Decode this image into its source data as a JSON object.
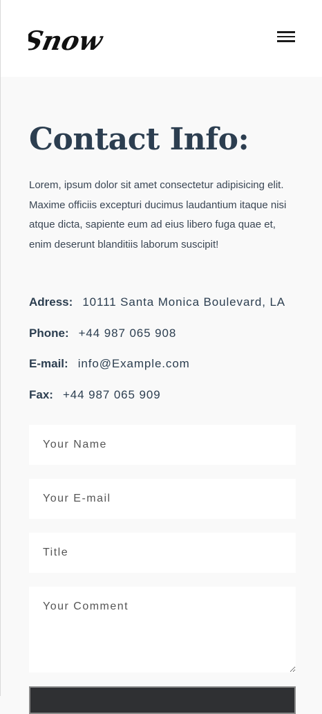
{
  "header": {
    "logo_text": "Snow",
    "menu_icon": "hamburger-menu-icon"
  },
  "contact": {
    "title": "Contact Info:",
    "description": "Lorem, ipsum dolor sit amet consectetur adipisicing elit. Maxime officiis excepturi ducimus laudantium itaque nisi atque dicta, sapiente eum ad eius libero fuga quae et, enim deserunt blanditiis laborum suscipit!",
    "address_label": "Adress:",
    "address_value": "10111 Santa Monica Boulevard, LA",
    "phone_label": "Phone:",
    "phone_value": "+44 987 065 908",
    "email_label": "E-mail:",
    "email_value": "info@Example.com",
    "fax_label": "Fax:",
    "fax_value": "+44 987 065 909"
  },
  "form": {
    "name_placeholder": "Your Name",
    "email_placeholder": "Your E-mail",
    "title_placeholder": "Title",
    "comment_placeholder": "Your Comment"
  },
  "colors": {
    "heading": "#2c3e50",
    "background": "#f9f9f9",
    "header_bg": "#ffffff",
    "button_bg": "#2f3033"
  }
}
